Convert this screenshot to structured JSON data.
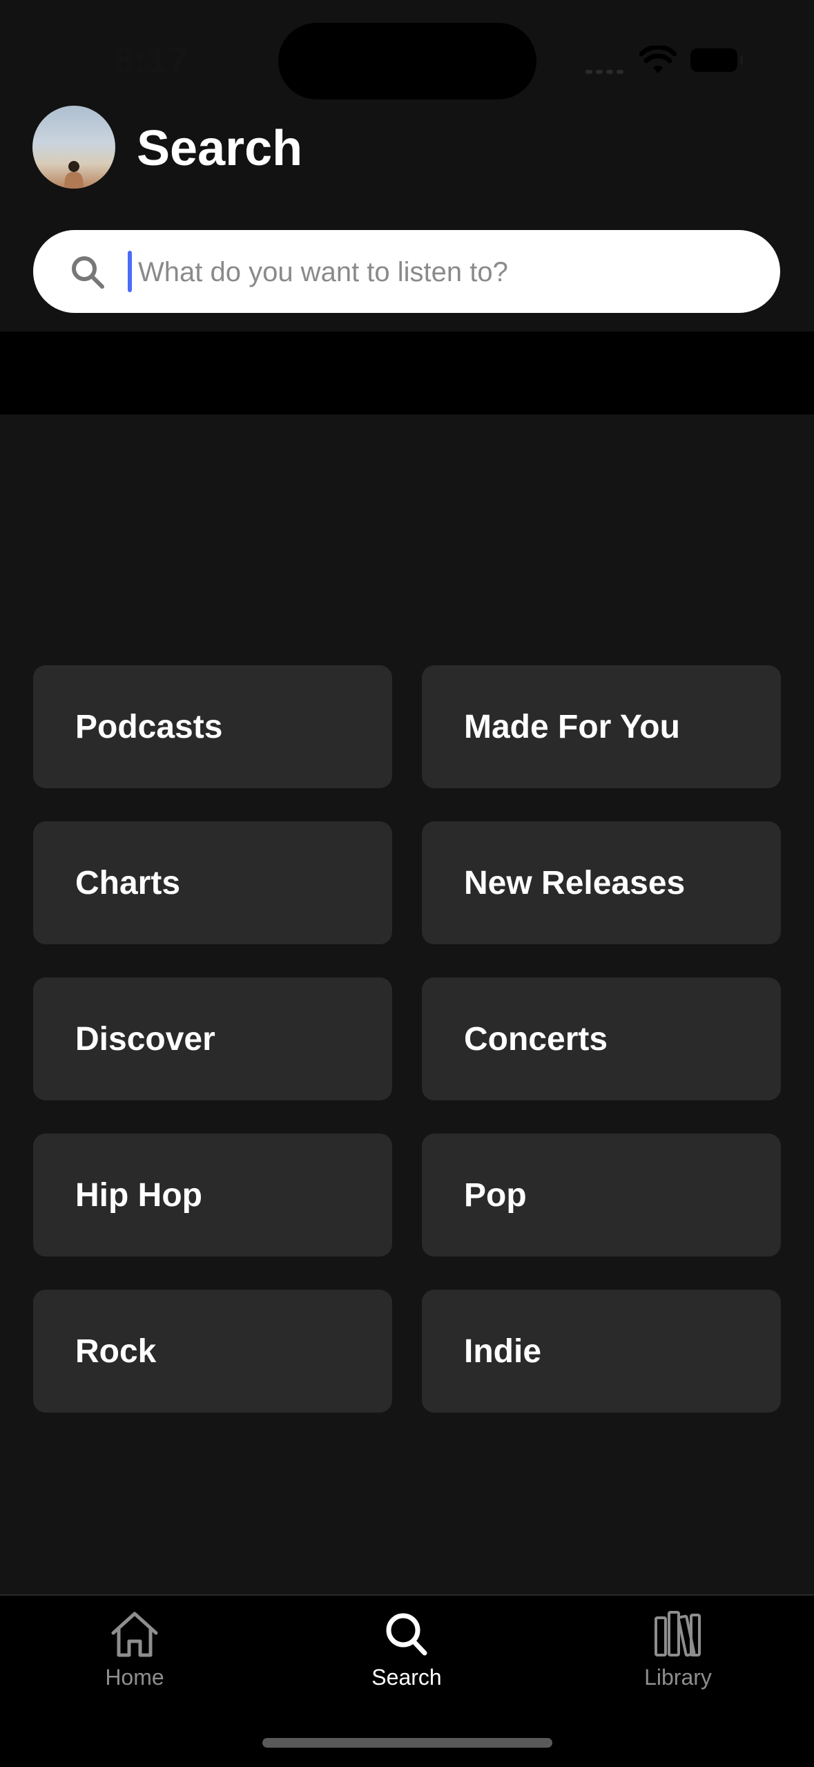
{
  "status_bar": {
    "time": "8:17",
    "icons": [
      "signal-icon",
      "wifi-icon",
      "battery-icon"
    ]
  },
  "header": {
    "title": "Search",
    "avatar_icon": "profile-avatar"
  },
  "search": {
    "placeholder": "What do you want to listen to?",
    "value": "",
    "icon": "search-icon",
    "caret_color": "#4a6cf7"
  },
  "categories": [
    {
      "label": "Podcasts"
    },
    {
      "label": "Made For You"
    },
    {
      "label": "Charts"
    },
    {
      "label": "New Releases"
    },
    {
      "label": "Discover"
    },
    {
      "label": "Concerts"
    },
    {
      "label": "Hip Hop"
    },
    {
      "label": "Pop"
    },
    {
      "label": "Rock"
    },
    {
      "label": "Indie"
    }
  ],
  "tab_bar": {
    "tabs": [
      {
        "label": "Home",
        "icon": "home-icon",
        "active": false
      },
      {
        "label": "Search",
        "icon": "search-icon",
        "active": true
      },
      {
        "label": "Library",
        "icon": "library-icon",
        "active": false
      }
    ]
  },
  "colors": {
    "background": "#121212",
    "tile": "#2a2a2a",
    "tab_inactive": "#8e8e8e",
    "tab_active": "#ffffff"
  }
}
